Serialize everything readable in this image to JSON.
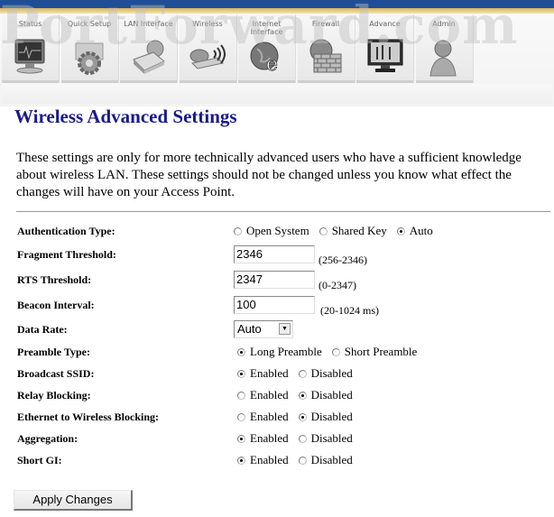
{
  "header": {
    "watermark": "PortForward.com",
    "nav": [
      {
        "label": "Status",
        "icon": "monitor-icon"
      },
      {
        "label": "Quick Setup",
        "icon": "gear-icon"
      },
      {
        "label": "LAN Interface",
        "icon": "network-drive-icon"
      },
      {
        "label": "Wireless",
        "icon": "wireless-adapter-icon"
      },
      {
        "label": "Internet Interface",
        "icon": "internet-globe-icon"
      },
      {
        "label": "Firewall",
        "icon": "firewall-icon"
      },
      {
        "label": "Advance",
        "icon": "advanced-monitor-icon"
      },
      {
        "label": "Admin",
        "icon": "user-icon"
      }
    ]
  },
  "page": {
    "title": "Wireless Advanced Settings",
    "intro": "These settings are only for more technically advanced users who have a sufficient knowledge about wireless LAN. These settings should not be changed unless you know what effect the changes will have on your Access Point."
  },
  "form": {
    "auth_type": {
      "label": "Authentication Type:",
      "options": [
        "Open System",
        "Shared Key",
        "Auto"
      ],
      "selected": "Auto"
    },
    "fragment": {
      "label": "Fragment Threshold:",
      "value": "2346",
      "hint": "(256-2346)"
    },
    "rts": {
      "label": "RTS Threshold:",
      "value": "2347",
      "hint": "(0-2347)"
    },
    "beacon": {
      "label": "Beacon Interval:",
      "value": "100",
      "hint": "(20-1024 ms)"
    },
    "data_rate": {
      "label": "Data Rate:",
      "value": "Auto"
    },
    "preamble": {
      "label": "Preamble Type:",
      "options": [
        "Long Preamble",
        "Short Preamble"
      ],
      "selected": "Long Preamble"
    },
    "broadcast_ssid": {
      "label": "Broadcast SSID:",
      "options": [
        "Enabled",
        "Disabled"
      ],
      "selected": "Enabled"
    },
    "relay_blocking": {
      "label": "Relay Blocking:",
      "options": [
        "Enabled",
        "Disabled"
      ],
      "selected": "Disabled"
    },
    "eth_wireless_blocking": {
      "label": "Ethernet to Wireless Blocking:",
      "options": [
        "Enabled",
        "Disabled"
      ],
      "selected": "Disabled"
    },
    "aggregation": {
      "label": "Aggregation:",
      "options": [
        "Enabled",
        "Disabled"
      ],
      "selected": "Enabled"
    },
    "short_gi": {
      "label": "Short GI:",
      "options": [
        "Enabled",
        "Disabled"
      ],
      "selected": "Enabled"
    }
  },
  "buttons": {
    "apply": "Apply Changes"
  },
  "colors": {
    "title": "#1a1a8c",
    "topbar": "#1f4e96",
    "goldbar": "#d7b45a"
  }
}
